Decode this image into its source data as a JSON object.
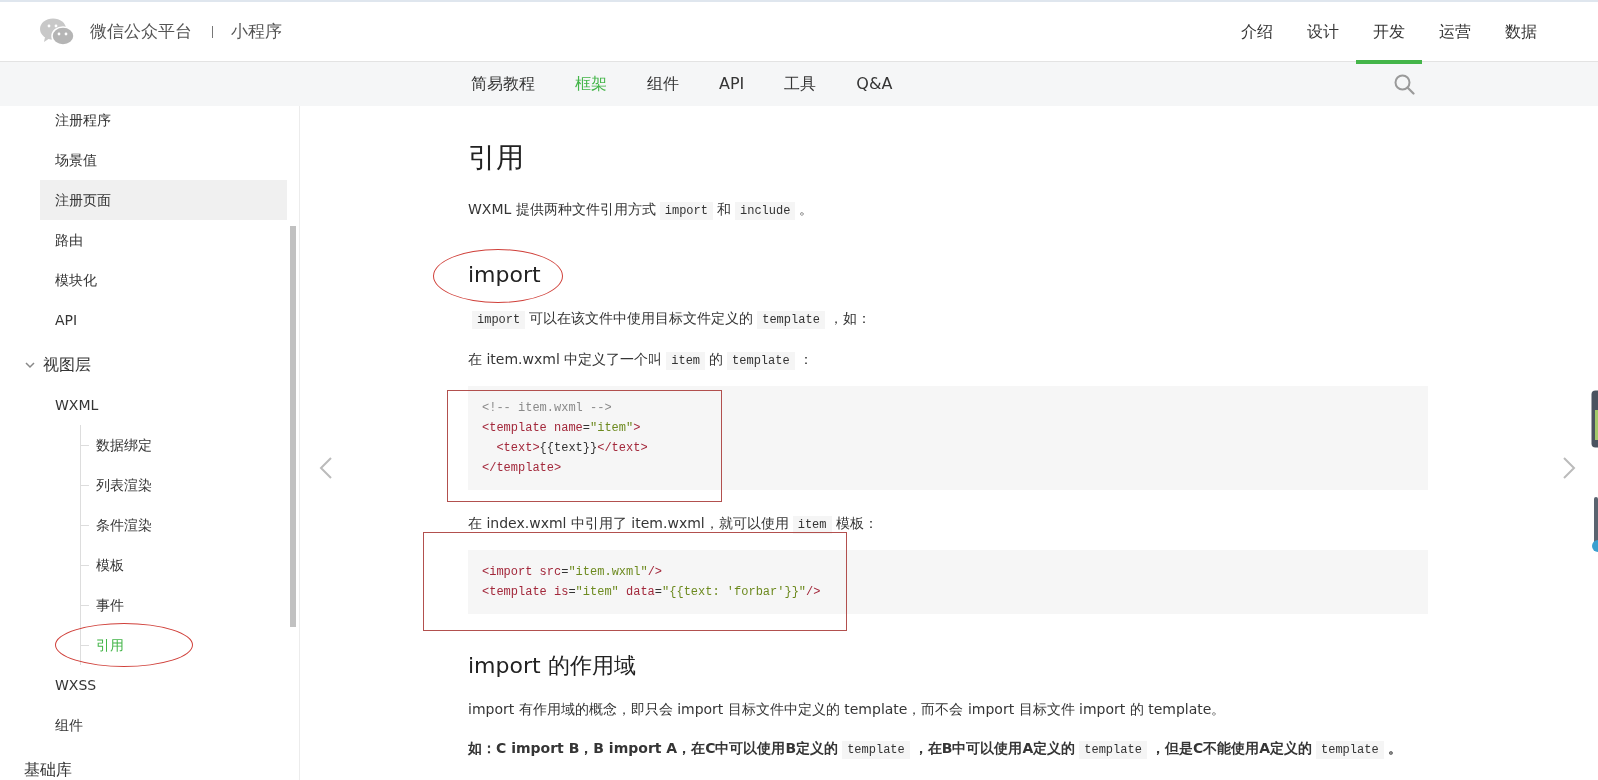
{
  "header": {
    "brand": "微信公众平台",
    "product": "小程序",
    "nav": [
      {
        "label": "介绍",
        "selected": false
      },
      {
        "label": "设计",
        "selected": false
      },
      {
        "label": "开发",
        "selected": true
      },
      {
        "label": "运营",
        "selected": false
      },
      {
        "label": "数据",
        "selected": false
      }
    ]
  },
  "subnav": {
    "tabs": [
      {
        "label": "简易教程",
        "selected": false
      },
      {
        "label": "框架",
        "selected": true
      },
      {
        "label": "组件",
        "selected": false
      },
      {
        "label": "API",
        "selected": false
      },
      {
        "label": "工具",
        "selected": false
      },
      {
        "label": "Q&A",
        "selected": false
      }
    ]
  },
  "sidebar": {
    "items": [
      {
        "kind": "page",
        "label": "注册程序",
        "selected": false,
        "highlighted": false,
        "circled": false
      },
      {
        "kind": "page",
        "label": "场景值",
        "selected": false,
        "highlighted": false,
        "circled": false
      },
      {
        "kind": "page",
        "label": "注册页面",
        "selected": false,
        "highlighted": true,
        "circled": false
      },
      {
        "kind": "page",
        "label": "路由",
        "selected": false,
        "highlighted": false,
        "circled": false
      },
      {
        "kind": "page",
        "label": "模块化",
        "selected": false,
        "highlighted": false,
        "circled": false
      },
      {
        "kind": "page",
        "label": "API",
        "selected": false,
        "highlighted": false,
        "circled": false
      },
      {
        "kind": "section",
        "label": "视图层",
        "children": [
          {
            "kind": "page",
            "label": "WXML",
            "selected": false,
            "highlighted": false,
            "circled": false,
            "children": [
              {
                "kind": "page",
                "label": "数据绑定",
                "selected": false,
                "highlighted": false,
                "circled": false
              },
              {
                "kind": "page",
                "label": "列表渲染",
                "selected": false,
                "highlighted": false,
                "circled": false
              },
              {
                "kind": "page",
                "label": "条件渲染",
                "selected": false,
                "highlighted": false,
                "circled": false
              },
              {
                "kind": "page",
                "label": "模板",
                "selected": false,
                "highlighted": false,
                "circled": false
              },
              {
                "kind": "page",
                "label": "事件",
                "selected": false,
                "highlighted": false,
                "circled": false
              },
              {
                "kind": "page",
                "label": "引用",
                "selected": true,
                "highlighted": false,
                "circled": true
              }
            ]
          },
          {
            "kind": "page",
            "label": "WXSS",
            "selected": false,
            "highlighted": false,
            "circled": false
          },
          {
            "kind": "page",
            "label": "组件",
            "selected": false,
            "highlighted": false,
            "circled": false
          }
        ]
      },
      {
        "kind": "section",
        "label": "基础库"
      }
    ]
  },
  "article": {
    "blocks": [
      {
        "kind": "h1",
        "text": "引用"
      },
      {
        "kind": "p",
        "bold": false,
        "segments": [
          {
            "kind": "text",
            "text": "WXML 提供两种文件引用方式"
          },
          {
            "kind": "code",
            "text": "import"
          },
          {
            "kind": "text",
            "text": "和"
          },
          {
            "kind": "code",
            "text": "include"
          },
          {
            "kind": "text",
            "text": "。"
          }
        ]
      },
      {
        "kind": "h2",
        "text": "import",
        "circled": true
      },
      {
        "kind": "p",
        "bold": false,
        "segments": [
          {
            "kind": "code",
            "text": "import"
          },
          {
            "kind": "text",
            "text": "可以在该文件中使用目标文件定义的"
          },
          {
            "kind": "code",
            "text": "template"
          },
          {
            "kind": "text",
            "text": "，如："
          }
        ]
      },
      {
        "kind": "p",
        "bold": false,
        "segments": [
          {
            "kind": "text",
            "text": "在 item.wxml 中定义了一个叫"
          },
          {
            "kind": "code",
            "text": "item"
          },
          {
            "kind": "text",
            "text": "的"
          },
          {
            "kind": "code",
            "text": "template"
          },
          {
            "kind": "text",
            "text": "："
          }
        ]
      },
      {
        "kind": "code",
        "boxed": true,
        "lines": [
          {
            "indented": false,
            "tokens": [
              {
                "kind": "comment",
                "text": "<!-- item.wxml -->"
              }
            ]
          },
          {
            "indented": false,
            "tokens": [
              {
                "kind": "tag",
                "text": "<template"
              },
              {
                "kind": "attr",
                "text": "name"
              },
              {
                "kind": "plain",
                "text": "="
              },
              {
                "kind": "string",
                "text": "\"item\""
              },
              {
                "kind": "tag",
                "text": ">"
              }
            ]
          },
          {
            "indented": true,
            "tokens": [
              {
                "kind": "tag",
                "text": "<text>"
              },
              {
                "kind": "plain",
                "text": "{{text}}"
              },
              {
                "kind": "tag",
                "text": "</text>"
              }
            ]
          },
          {
            "indented": false,
            "tokens": [
              {
                "kind": "tag",
                "text": "</template>"
              }
            ]
          }
        ]
      },
      {
        "kind": "p",
        "bold": false,
        "segments": [
          {
            "kind": "text",
            "text": "在 index.wxml 中引用了 item.wxml，就可以使用"
          },
          {
            "kind": "code",
            "text": "item"
          },
          {
            "kind": "text",
            "text": "模板："
          }
        ]
      },
      {
        "kind": "code",
        "boxed": true,
        "lines": [
          {
            "indented": false,
            "tokens": [
              {
                "kind": "tag",
                "text": "<import"
              },
              {
                "kind": "attr",
                "text": "src"
              },
              {
                "kind": "plain",
                "text": "="
              },
              {
                "kind": "string",
                "text": "\"item.wxml\""
              },
              {
                "kind": "tag",
                "text": "/>"
              }
            ]
          },
          {
            "indented": false,
            "tokens": [
              {
                "kind": "tag",
                "text": "<template"
              },
              {
                "kind": "attr",
                "text": "is"
              },
              {
                "kind": "plain",
                "text": "="
              },
              {
                "kind": "string",
                "text": "\"item\""
              },
              {
                "kind": "attr",
                "text": "data"
              },
              {
                "kind": "plain",
                "text": "="
              },
              {
                "kind": "string",
                "text": "\"{{text: 'forbar'}}\""
              },
              {
                "kind": "tag",
                "text": "/>"
              }
            ]
          }
        ]
      },
      {
        "kind": "h2",
        "text": "import 的作用域",
        "circled": false
      },
      {
        "kind": "p",
        "bold": false,
        "segments": [
          {
            "kind": "text",
            "text": "import 有作用域的概念，即只会 import 目标文件中定义的 template，而不会 import 目标文件 import 的 template。"
          }
        ]
      },
      {
        "kind": "p",
        "bold": true,
        "segments": [
          {
            "kind": "text",
            "text": "如：C import B，B import A，在C中可以使用B定义的"
          },
          {
            "kind": "code",
            "text": "template"
          },
          {
            "kind": "text",
            "text": "，在B中可以使用A定义的"
          },
          {
            "kind": "code",
            "text": "template"
          },
          {
            "kind": "text",
            "text": "，但是C不能使用A定义的"
          },
          {
            "kind": "code",
            "text": "template"
          },
          {
            "kind": "text",
            "text": "。"
          }
        ]
      }
    ]
  }
}
